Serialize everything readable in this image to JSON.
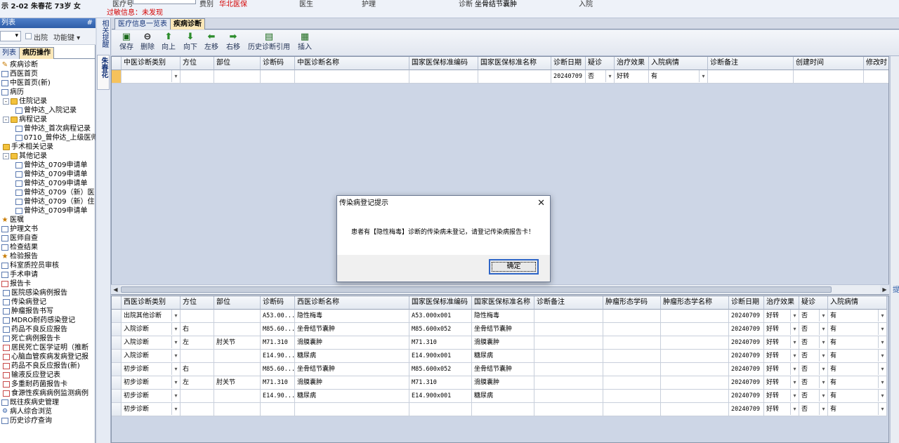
{
  "header": {
    "patient_info": "示 2-02  朱春花  73岁  女",
    "allergy": "过敏信息：未发现",
    "fields": [
      {
        "label": "医疗号",
        "value": ""
      },
      {
        "label": "费别",
        "value": "华北医保"
      },
      {
        "label": "医生",
        "value": ""
      },
      {
        "label": "护理",
        "value": ""
      },
      {
        "label": "诊断",
        "value": "坐骨结节囊肿"
      },
      {
        "label": "入院",
        "value": ""
      }
    ]
  },
  "left_panel": {
    "title": "列表",
    "pin": "#",
    "toolbar": {
      "dropdown": "▾",
      "discharged_label": "出院",
      "function_key_label": "功能键 ▾"
    },
    "tabs": [
      "列表",
      "病历操作"
    ],
    "tree": [
      {
        "label": "疾病诊断",
        "icon": "pen-icon",
        "level": 0
      },
      {
        "label": "西医首页",
        "icon": "doc-icon",
        "level": 0
      },
      {
        "label": "中医首页(新)",
        "icon": "doc-icon",
        "level": 0
      },
      {
        "label": "病历",
        "icon": "doc-icon",
        "level": 0
      },
      {
        "label": "住院记录",
        "icon": "folder-icon",
        "level": 1,
        "expand": "-"
      },
      {
        "label": "曾仲达_入院记录",
        "icon": "doc-icon",
        "level": 2
      },
      {
        "label": "病程记录",
        "icon": "folder-icon",
        "level": 1,
        "expand": "-"
      },
      {
        "label": "曾仲达_首次病程记录",
        "icon": "doc-icon",
        "level": 2
      },
      {
        "label": "0710_曾仲达_上级医师",
        "icon": "doc-icon",
        "level": 2
      },
      {
        "label": "手术相关记录",
        "icon": "folder-icon",
        "level": 1
      },
      {
        "label": "其他记录",
        "icon": "folder-icon",
        "level": 1,
        "expand": "-"
      },
      {
        "label": "曾仲达_0709申请单",
        "icon": "doc-icon",
        "level": 2
      },
      {
        "label": "曾仲达_0709申请单",
        "icon": "doc-icon",
        "level": 2
      },
      {
        "label": "曾仲达_0709申请单",
        "icon": "doc-icon",
        "level": 2
      },
      {
        "label": "曾仲达_0709（新）医",
        "icon": "doc-icon",
        "level": 2
      },
      {
        "label": "曾仲达_0709（新）住",
        "icon": "doc-icon",
        "level": 2
      },
      {
        "label": "曾仲达_0709申请单",
        "icon": "doc-icon",
        "level": 2
      },
      {
        "label": "医嘱",
        "icon": "star-icon",
        "level": 0
      },
      {
        "label": "护理文书",
        "icon": "doc-icon",
        "level": 0
      },
      {
        "label": "医师自查",
        "icon": "doc-icon",
        "level": 0
      },
      {
        "label": "检查结果",
        "icon": "doc-icon",
        "level": 0
      },
      {
        "label": "检验报告",
        "icon": "star-icon",
        "level": 0
      },
      {
        "label": "科室质控员审核",
        "icon": "doc-icon",
        "level": 0
      },
      {
        "label": "手术申请",
        "icon": "doc-icon",
        "level": 0
      },
      {
        "label": "报告卡",
        "icon": "red-doc-icon",
        "level": 0
      },
      {
        "label": "医院感染病例报告",
        "icon": "doc-icon",
        "level": 1
      },
      {
        "label": "传染病登记",
        "icon": "doc-icon",
        "level": 1
      },
      {
        "label": "肿瘤报告书写",
        "icon": "doc-icon",
        "level": 1
      },
      {
        "label": "MDRO耐药感染登记",
        "icon": "doc-icon",
        "level": 1
      },
      {
        "label": "药品不良反应报告",
        "icon": "doc-icon",
        "level": 1
      },
      {
        "label": "死亡病例报告卡",
        "icon": "doc-icon",
        "level": 1
      },
      {
        "label": "居民死亡医学证明（推断",
        "icon": "red-doc-icon",
        "level": 1
      },
      {
        "label": "心脑血管疾病发病登记报",
        "icon": "red-doc-icon",
        "level": 1
      },
      {
        "label": "药品不良反应报告(新)",
        "icon": "red-doc-icon",
        "level": 1
      },
      {
        "label": "输液反应登记表",
        "icon": "red-doc-icon",
        "level": 1
      },
      {
        "label": "多重耐药菌报告卡",
        "icon": "red-doc-icon",
        "level": 1
      },
      {
        "label": "食源性疾病病例监测病例",
        "icon": "red-doc-icon",
        "level": 1
      },
      {
        "label": "既往疾病史管理",
        "icon": "doc-icon",
        "level": 0
      },
      {
        "label": "病人综合浏览",
        "icon": "gear-icon",
        "level": 0
      },
      {
        "label": "历史诊疗查询",
        "icon": "doc-icon",
        "level": 0
      }
    ]
  },
  "side_strip": {
    "tab1": "相关提醒",
    "tab2": "朱春花"
  },
  "main_tabs": [
    "医疗信息一览表",
    "疾病诊断"
  ],
  "toolbar": [
    {
      "label": "保存",
      "icon": "save-icon",
      "glyph": "▣",
      "color": "#1e6b1e"
    },
    {
      "label": "删除",
      "icon": "delete-icon",
      "glyph": "⊖",
      "color": "#222222"
    },
    {
      "label": "向上",
      "icon": "arrow-up-icon",
      "glyph": "⬆",
      "color": "#2c8c2c"
    },
    {
      "label": "向下",
      "icon": "arrow-down-icon",
      "glyph": "⬇",
      "color": "#2c8c2c"
    },
    {
      "label": "左移",
      "icon": "arrow-left-icon",
      "glyph": "⬅",
      "color": "#2c8c2c"
    },
    {
      "label": "右移",
      "icon": "arrow-right-icon",
      "glyph": "➡",
      "color": "#2c8c2c"
    },
    {
      "label": "历史诊断引用",
      "icon": "history-icon",
      "glyph": "▤",
      "color": "#1e6b1e"
    },
    {
      "label": "插入",
      "icon": "insert-icon",
      "glyph": "▦",
      "color": "#1e6b1e"
    }
  ],
  "tcm_grid": {
    "columns": [
      "中医诊断类别",
      "方位",
      "部位",
      "诊断码",
      "中医诊断名称",
      "国家医保标准编码",
      "国家医保标准名称",
      "诊断日期",
      "疑诊",
      "治疗效果",
      "入院病情",
      "诊断备注",
      "创建时间",
      "修改时"
    ],
    "rows": [
      {
        "category": "",
        "orientation": "",
        "site": "",
        "code": "",
        "name": "",
        "insurance_code": "",
        "insurance_name": "",
        "date": "20240709",
        "suspected": "否",
        "effect": "好转",
        "admission": "有",
        "remark": "",
        "created": "",
        "modified": ""
      }
    ]
  },
  "wm_grid": {
    "columns": [
      "西医诊断类别",
      "方位",
      "部位",
      "诊断码",
      "西医诊断名称",
      "国家医保标准编码",
      "国家医保标准名称",
      "诊断备注",
      "肿瘤形态学码",
      "肿瘤形态学名称",
      "诊断日期",
      "治疗效果",
      "疑诊",
      "入院病情"
    ],
    "rows": [
      {
        "category": "出院其他诊断",
        "orientation": "",
        "site": "",
        "code": "A53.00...",
        "name": "隐性梅毒",
        "insurance_code": "A53.000x001",
        "insurance_name": "隐性梅毒",
        "remark": "",
        "tumor_code": "",
        "tumor_name": "",
        "date": "20240709",
        "effect": "好转",
        "suspected": "否",
        "admission": "有"
      },
      {
        "category": "入院诊断",
        "orientation": "右",
        "site": "",
        "code": "M85.60...",
        "name": "坐骨结节囊肿",
        "insurance_code": "M85.600x052",
        "insurance_name": "坐骨结节囊肿",
        "remark": "",
        "tumor_code": "",
        "tumor_name": "",
        "date": "20240709",
        "effect": "好转",
        "suspected": "否",
        "admission": "有"
      },
      {
        "category": "入院诊断",
        "orientation": "左",
        "site": "肘关节",
        "code": "M71.310",
        "name": "滑膜囊肿",
        "insurance_code": "M71.310",
        "insurance_name": "滑膜囊肿",
        "remark": "",
        "tumor_code": "",
        "tumor_name": "",
        "date": "20240709",
        "effect": "好转",
        "suspected": "否",
        "admission": "有"
      },
      {
        "category": "入院诊断",
        "orientation": "",
        "site": "",
        "code": "E14.90...",
        "name": "糖尿病",
        "insurance_code": "E14.900x001",
        "insurance_name": "糖尿病",
        "remark": "",
        "tumor_code": "",
        "tumor_name": "",
        "date": "20240709",
        "effect": "好转",
        "suspected": "否",
        "admission": "有"
      },
      {
        "category": "初步诊断",
        "orientation": "右",
        "site": "",
        "code": "M85.60...",
        "name": "坐骨结节囊肿",
        "insurance_code": "M85.600x052",
        "insurance_name": "坐骨结节囊肿",
        "remark": "",
        "tumor_code": "",
        "tumor_name": "",
        "date": "20240709",
        "effect": "好转",
        "suspected": "否",
        "admission": "有"
      },
      {
        "category": "初步诊断",
        "orientation": "左",
        "site": "肘关节",
        "code": "M71.310",
        "name": "滑膜囊肿",
        "insurance_code": "M71.310",
        "insurance_name": "滑膜囊肿",
        "remark": "",
        "tumor_code": "",
        "tumor_name": "",
        "date": "20240709",
        "effect": "好转",
        "suspected": "否",
        "admission": "有"
      },
      {
        "category": "初步诊断",
        "orientation": "",
        "site": "",
        "code": "E14.90...",
        "name": "糖尿病",
        "insurance_code": "E14.900x001",
        "insurance_name": "糖尿病",
        "remark": "",
        "tumor_code": "",
        "tumor_name": "",
        "date": "20240709",
        "effect": "好转",
        "suspected": "否",
        "admission": "有"
      },
      {
        "category": "初步诊断",
        "orientation": "",
        "site": "",
        "code": "",
        "name": "",
        "insurance_code": "",
        "insurance_name": "",
        "remark": "",
        "tumor_code": "",
        "tumor_name": "",
        "date": "20240709",
        "effect": "好转",
        "suspected": "否",
        "admission": "有"
      }
    ]
  },
  "dialog": {
    "title": "传染病登记提示",
    "close": "✕",
    "message": "患者有【隐性梅毒】诊断的传染病未登记，请登记传染病报告卡！",
    "ok_label": "确定"
  },
  "right_edge_label": "提",
  "scroll": {
    "left_arrow": "◀",
    "right_arrow": "▶",
    "dropdown_arrow": "▾"
  }
}
